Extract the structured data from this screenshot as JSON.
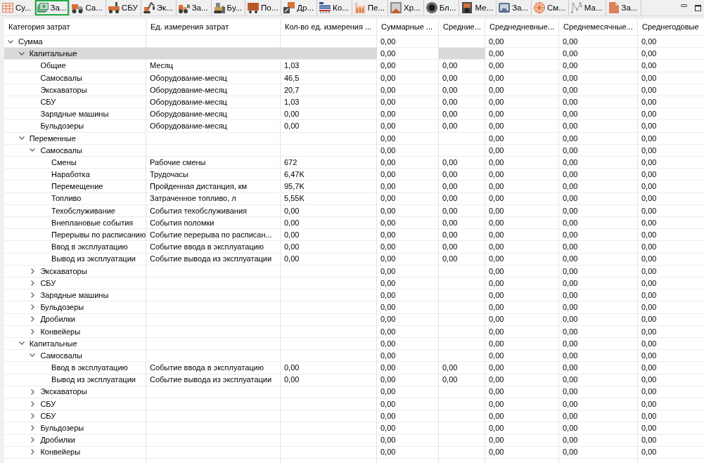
{
  "tabs": [
    {
      "label": "Су...",
      "selected": false
    },
    {
      "label": "За...",
      "selected": true
    },
    {
      "label": "Са...",
      "selected": false
    },
    {
      "label": "СБУ",
      "selected": false
    },
    {
      "label": "Эк...",
      "selected": false
    },
    {
      "label": "За...",
      "selected": false
    },
    {
      "label": "Бу...",
      "selected": false
    },
    {
      "label": "По...",
      "selected": false
    },
    {
      "label": "Др...",
      "selected": false
    },
    {
      "label": "Ко...",
      "selected": false
    },
    {
      "label": "Пе...",
      "selected": false
    },
    {
      "label": "Хр...",
      "selected": false
    },
    {
      "label": "Бл...",
      "selected": false
    },
    {
      "label": "Ме...",
      "selected": false
    },
    {
      "label": "За...",
      "selected": false
    },
    {
      "label": "См...",
      "selected": false
    },
    {
      "label": "Ма...",
      "selected": false
    },
    {
      "label": "За...",
      "selected": false
    }
  ],
  "table": {
    "columns": [
      {
        "label": "Категория затрат"
      },
      {
        "label": "Ед. измерения затрат"
      },
      {
        "label": "Кол-во ед. измерения ..."
      },
      {
        "label": "Суммарные ..."
      },
      {
        "label": "Средние..."
      },
      {
        "label": "Среднедневные..."
      },
      {
        "label": "Среднемесячные..."
      },
      {
        "label": "Среднегодовые"
      }
    ],
    "rows": [
      {
        "label": "Сумма",
        "kind": "group",
        "expanded": true,
        "selected": false,
        "total": "0,00",
        "daily": "0,00",
        "monthly": "0,00",
        "yearly": "0,00",
        "children": [
          {
            "label": "Капитальные",
            "kind": "group",
            "expanded": true,
            "selected": true,
            "total": "0,00",
            "daily": "0,00",
            "monthly": "0,00",
            "yearly": "0,00",
            "children": [
              {
                "label": "Общие",
                "kind": "item",
                "selected": false,
                "unit": "Месяц",
                "quantity": "1,03",
                "total": "0,00",
                "average": "0,00",
                "daily": "0,00",
                "monthly": "0,00",
                "yearly": "0,00"
              },
              {
                "label": "Самосвалы",
                "kind": "item",
                "selected": false,
                "unit": "Оборудование-месяц",
                "quantity": "46,5",
                "total": "0,00",
                "average": "0,00",
                "daily": "0,00",
                "monthly": "0,00",
                "yearly": "0,00"
              },
              {
                "label": "Экскаваторы",
                "kind": "item",
                "selected": false,
                "unit": "Оборудование-месяц",
                "quantity": "20,7",
                "total": "0,00",
                "average": "0,00",
                "daily": "0,00",
                "monthly": "0,00",
                "yearly": "0,00"
              },
              {
                "label": "СБУ",
                "kind": "item",
                "selected": false,
                "unit": "Оборудование-месяц",
                "quantity": "1,03",
                "total": "0,00",
                "average": "0,00",
                "daily": "0,00",
                "monthly": "0,00",
                "yearly": "0,00"
              },
              {
                "label": "Зарядные машины",
                "kind": "item",
                "selected": false,
                "unit": "Оборудование-месяц",
                "quantity": "0,00",
                "total": "0,00",
                "average": "0,00",
                "daily": "0,00",
                "monthly": "0,00",
                "yearly": "0,00"
              },
              {
                "label": "Бульдозеры",
                "kind": "item",
                "selected": false,
                "unit": "Оборудование-месяц",
                "quantity": "0,00",
                "total": "0,00",
                "average": "0,00",
                "daily": "0,00",
                "monthly": "0,00",
                "yearly": "0,00"
              }
            ]
          },
          {
            "label": "Переменные",
            "kind": "group",
            "expanded": true,
            "selected": false,
            "total": "0,00",
            "daily": "0,00",
            "monthly": "0,00",
            "yearly": "0,00",
            "children": [
              {
                "label": "Самосвалы",
                "kind": "group",
                "expanded": true,
                "selected": false,
                "total": "0,00",
                "daily": "0,00",
                "monthly": "0,00",
                "yearly": "0,00",
                "children": [
                  {
                    "label": "Смены",
                    "kind": "item",
                    "selected": false,
                    "unit": "Рабочие смены",
                    "quantity": "672",
                    "total": "0,00",
                    "average": "0,00",
                    "daily": "0,00",
                    "monthly": "0,00",
                    "yearly": "0,00"
                  },
                  {
                    "label": "Наработка",
                    "kind": "item",
                    "selected": false,
                    "unit": "Трудочасы",
                    "quantity": "6,47K",
                    "total": "0,00",
                    "average": "0,00",
                    "daily": "0,00",
                    "monthly": "0,00",
                    "yearly": "0,00"
                  },
                  {
                    "label": "Перемещение",
                    "kind": "item",
                    "selected": false,
                    "unit": "Пройденная дистанция, км",
                    "quantity": "95,7K",
                    "total": "0,00",
                    "average": "0,00",
                    "daily": "0,00",
                    "monthly": "0,00",
                    "yearly": "0,00"
                  },
                  {
                    "label": "Топливо",
                    "kind": "item",
                    "selected": false,
                    "unit": "Затраченное топливо, л",
                    "quantity": "5,55K",
                    "total": "0,00",
                    "average": "0,00",
                    "daily": "0,00",
                    "monthly": "0,00",
                    "yearly": "0,00"
                  },
                  {
                    "label": "Техобслуживание",
                    "kind": "item",
                    "selected": false,
                    "unit": "События техобслуживания",
                    "quantity": "0,00",
                    "total": "0,00",
                    "average": "0,00",
                    "daily": "0,00",
                    "monthly": "0,00",
                    "yearly": "0,00"
                  },
                  {
                    "label": "Внеплановые события",
                    "kind": "item",
                    "selected": false,
                    "unit": "События поломки",
                    "quantity": "0,00",
                    "total": "0,00",
                    "average": "0,00",
                    "daily": "0,00",
                    "monthly": "0,00",
                    "yearly": "0,00"
                  },
                  {
                    "label": "Перерывы по расписанию",
                    "kind": "item",
                    "selected": false,
                    "unit": "Событие перерыва по расписан...",
                    "quantity": "0,00",
                    "total": "0,00",
                    "average": "0,00",
                    "daily": "0,00",
                    "monthly": "0,00",
                    "yearly": "0,00"
                  },
                  {
                    "label": "Ввод в эксплуатацию",
                    "kind": "item",
                    "selected": false,
                    "unit": "Событие ввода в эксплуатацию",
                    "quantity": "0,00",
                    "total": "0,00",
                    "average": "0,00",
                    "daily": "0,00",
                    "monthly": "0,00",
                    "yearly": "0,00"
                  },
                  {
                    "label": "Вывод из эксплуатации",
                    "kind": "item",
                    "selected": false,
                    "unit": "Событие вывода из эксплуатации",
                    "quantity": "0,00",
                    "total": "0,00",
                    "average": "0,00",
                    "daily": "0,00",
                    "monthly": "0,00",
                    "yearly": "0,00"
                  }
                ]
              },
              {
                "label": "Экскаваторы",
                "kind": "group",
                "expanded": false,
                "selected": false,
                "total": "0,00",
                "daily": "0,00",
                "monthly": "0,00",
                "yearly": "0,00"
              },
              {
                "label": "СБУ",
                "kind": "group",
                "expanded": false,
                "selected": false,
                "total": "0,00",
                "daily": "0,00",
                "monthly": "0,00",
                "yearly": "0,00"
              },
              {
                "label": "Зарядные машины",
                "kind": "group",
                "expanded": false,
                "selected": false,
                "total": "0,00",
                "daily": "0,00",
                "monthly": "0,00",
                "yearly": "0,00"
              },
              {
                "label": "Бульдозеры",
                "kind": "group",
                "expanded": false,
                "selected": false,
                "total": "0,00",
                "daily": "0,00",
                "monthly": "0,00",
                "yearly": "0,00"
              },
              {
                "label": "Дробилки",
                "kind": "group",
                "expanded": false,
                "selected": false,
                "total": "0,00",
                "daily": "0,00",
                "monthly": "0,00",
                "yearly": "0,00"
              },
              {
                "label": "Конвейеры",
                "kind": "group",
                "expanded": false,
                "selected": false,
                "total": "0,00",
                "daily": "0,00",
                "monthly": "0,00",
                "yearly": "0,00"
              }
            ]
          },
          {
            "label": "Капитальные",
            "kind": "group",
            "expanded": true,
            "selected": false,
            "total": "0,00",
            "daily": "0,00",
            "monthly": "0,00",
            "yearly": "0,00",
            "children": [
              {
                "label": "Самосвалы",
                "kind": "group",
                "expanded": true,
                "selected": false,
                "total": "0,00",
                "daily": "0,00",
                "monthly": "0,00",
                "yearly": "0,00",
                "children": [
                  {
                    "label": "Ввод в эксплуатацию",
                    "kind": "item",
                    "selected": false,
                    "unit": "Событие ввода в эксплуатацию",
                    "quantity": "0,00",
                    "total": "0,00",
                    "average": "0,00",
                    "daily": "0,00",
                    "monthly": "0,00",
                    "yearly": "0,00"
                  },
                  {
                    "label": "Вывод из эксплуатации",
                    "kind": "item",
                    "selected": false,
                    "unit": "Событие вывода из эксплуатации",
                    "quantity": "0,00",
                    "total": "0,00",
                    "average": "0,00",
                    "daily": "0,00",
                    "monthly": "0,00",
                    "yearly": "0,00"
                  }
                ]
              },
              {
                "label": "Экскаваторы",
                "kind": "group",
                "expanded": false,
                "selected": false,
                "total": "0,00",
                "daily": "0,00",
                "monthly": "0,00",
                "yearly": "0,00"
              },
              {
                "label": "СБУ",
                "kind": "group",
                "expanded": false,
                "selected": false,
                "total": "0,00",
                "daily": "0,00",
                "monthly": "0,00",
                "yearly": "0,00"
              },
              {
                "label": "СБУ",
                "kind": "group",
                "expanded": false,
                "selected": false,
                "total": "0,00",
                "daily": "0,00",
                "monthly": "0,00",
                "yearly": "0,00"
              },
              {
                "label": "Бульдозеры",
                "kind": "group",
                "expanded": false,
                "selected": false,
                "total": "0,00",
                "daily": "0,00",
                "monthly": "0,00",
                "yearly": "0,00"
              },
              {
                "label": "Дробилки",
                "kind": "group",
                "expanded": false,
                "selected": false,
                "total": "0,00",
                "daily": "0,00",
                "monthly": "0,00",
                "yearly": "0,00"
              },
              {
                "label": "Конвейеры",
                "kind": "group",
                "expanded": false,
                "selected": false,
                "total": "0,00",
                "daily": "0,00",
                "monthly": "0,00",
                "yearly": "0,00"
              }
            ]
          }
        ]
      }
    ]
  }
}
